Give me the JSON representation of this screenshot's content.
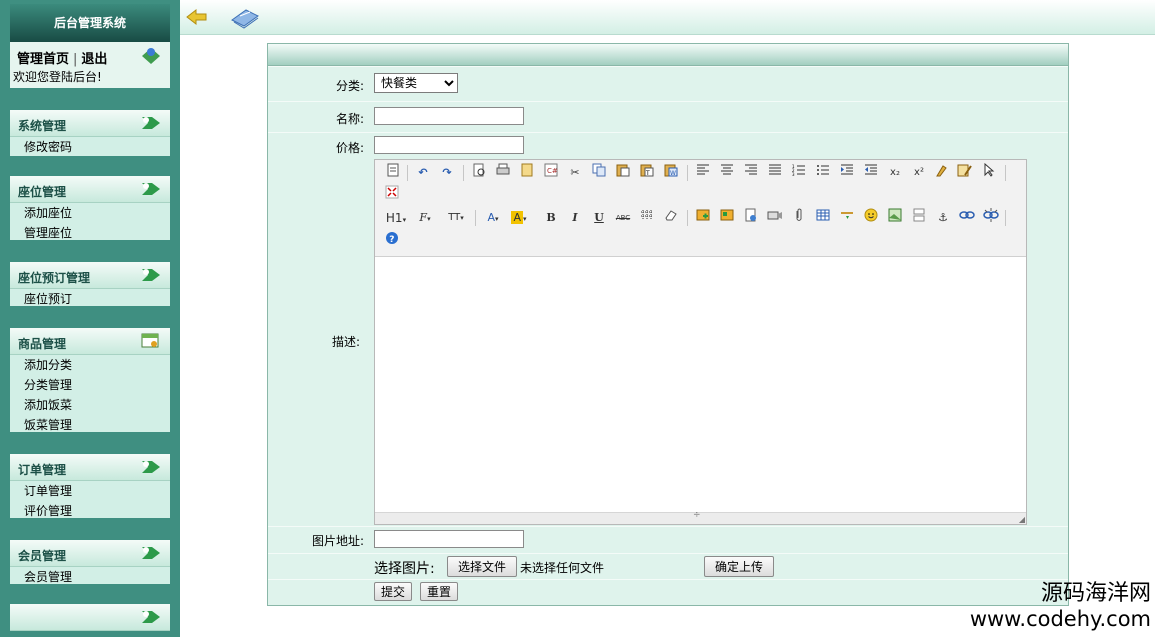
{
  "sidebar": {
    "system_title": "后台管理系统",
    "home_link": "管理首页",
    "separator": "|",
    "logout_link": "退出",
    "welcome": "欢迎您登陆后台!",
    "sections": [
      {
        "title": "系统管理",
        "items": [
          "修改密码"
        ]
      },
      {
        "title": "座位管理",
        "items": [
          "添加座位",
          "管理座位"
        ]
      },
      {
        "title": "座位预订管理",
        "items": [
          "座位预订"
        ]
      },
      {
        "title": "商品管理",
        "items": [
          "添加分类",
          "分类管理",
          "添加饭菜",
          "饭菜管理"
        ]
      },
      {
        "title": "订单管理",
        "items": [
          "订单管理",
          "评价管理"
        ]
      },
      {
        "title": "会员管理",
        "items": [
          "会员管理"
        ]
      },
      {
        "title": "",
        "items": []
      }
    ]
  },
  "form": {
    "category_label": "分类:",
    "category_value": "快餐类",
    "name_label": "名称:",
    "price_label": "价格:",
    "description_label": "描述:",
    "image_url_label": "图片地址:",
    "choose_image_label": "选择图片:",
    "choose_file_button": "选择文件",
    "no_file_text": "未选择任何文件",
    "upload_button": "确定上传",
    "submit_button": "提交",
    "reset_button": "重置"
  },
  "editor": {
    "toolbar_row1": [
      "source-icon",
      "undo-icon",
      "redo-icon",
      "preview-icon",
      "print-icon",
      "template-icon",
      "code-icon",
      "cut-icon",
      "copy-icon",
      "paste-icon",
      "paste-text-icon",
      "paste-word-icon",
      "align-left-icon",
      "align-center-icon",
      "align-right-icon",
      "align-justify-icon",
      "ordered-list-icon",
      "unordered-list-icon",
      "indent-icon",
      "outdent-icon",
      "subscript-icon",
      "superscript-icon",
      "clear-format-icon",
      "select-all-icon",
      "cursor-icon",
      "fullscreen-icon"
    ],
    "heading_label": "H1",
    "font_label": "F",
    "size_label": "TT",
    "bold": "B",
    "italic": "I",
    "underline": "U",
    "strike": "ABC"
  },
  "watermark": {
    "line1": "源码海洋网",
    "line2": "www.codehy.com"
  },
  "colors": {
    "sidebar_bg": "#3f8f81",
    "panel_bg": "#d2efe6",
    "form_bg": "#dff3ec"
  }
}
